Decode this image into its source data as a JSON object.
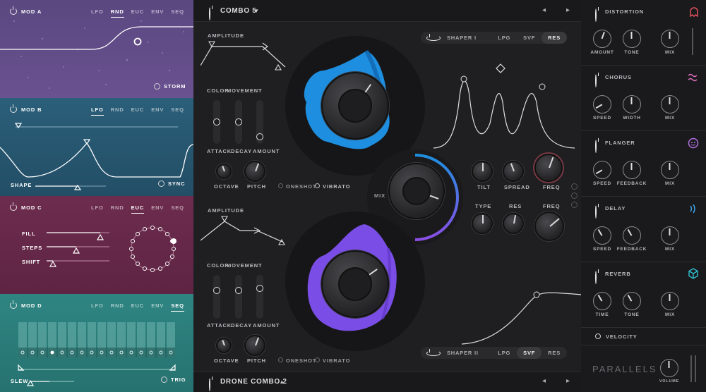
{
  "mods": [
    {
      "title": "MOD A",
      "tabs": [
        "LFO",
        "RND",
        "EUC",
        "ENV",
        "SEQ"
      ],
      "active": 1,
      "extra": "STORM",
      "color": "#5e4a7f"
    },
    {
      "title": "MOD B",
      "tabs": [
        "LFO",
        "RND",
        "EUC",
        "ENV",
        "SEQ"
      ],
      "active": 0,
      "shape_label": "SHAPE",
      "extra": "SYNC",
      "color": "#2a5a74"
    },
    {
      "title": "MOD C",
      "tabs": [
        "LFO",
        "RND",
        "EUC",
        "ENV",
        "SEQ"
      ],
      "active": 2,
      "rows": [
        "FILL",
        "STEPS",
        "SHIFT"
      ],
      "color": "#6a2a4a"
    },
    {
      "title": "MOD D",
      "tabs": [
        "LFO",
        "RND",
        "EUC",
        "ENV",
        "SEQ"
      ],
      "active": 4,
      "slew": "SLEW",
      "extra": "TRIG",
      "color": "#2d7d7a"
    }
  ],
  "center": {
    "preset_top": "COMBO 5",
    "preset_top_arrow": "▾",
    "preset_bottom": "DRONE COMBO 2",
    "preset_bottom_arrow": "▴",
    "nav_prev": "◂",
    "nav_next": "▸",
    "amplitude": "AMPLITUDE",
    "color": "COLOR",
    "movement": "MOVEMENT",
    "attack": "ATTACK",
    "decay": "DECAY",
    "amount": "AMOUNT",
    "octave": "OCTAVE",
    "pitch": "PITCH",
    "oneshot": "ONESHOT",
    "vibrato": "VIBRATO",
    "mix": "MIX",
    "shaper1": {
      "name": "SHAPER I",
      "opts": [
        "LPG",
        "SVF",
        "RES"
      ],
      "sel": 2
    },
    "shaper2": {
      "name": "SHAPER II",
      "opts": [
        "LPG",
        "SVF",
        "RES"
      ],
      "sel": 1
    },
    "tilt": "TILT",
    "spread": "SPREAD",
    "freq": "FREQ",
    "type": "TYPE",
    "res": "RES",
    "accent_blue": "#1e8fe0",
    "accent_purple": "#7a4ee6"
  },
  "fx": [
    {
      "name": "DISTORTION",
      "knobs": [
        "AMOUNT",
        "TONE"
      ],
      "mix": "MIX",
      "icon": "ghost-icon",
      "icon_color": "#e0505a"
    },
    {
      "name": "CHORUS",
      "knobs": [
        "SPEED",
        "WIDTH"
      ],
      "mix": "MIX",
      "icon": "wave-icon",
      "icon_color": "#e070c0"
    },
    {
      "name": "FLANGER",
      "knobs": [
        "SPEED",
        "FEEDBACK"
      ],
      "mix": "MIX",
      "icon": "face-icon",
      "icon_color": "#b070e0"
    },
    {
      "name": "DELAY",
      "knobs": [
        "SPEED",
        "FEEDBACK"
      ],
      "mix": "MIX",
      "icon": "signal-icon",
      "icon_color": "#40a0e0"
    },
    {
      "name": "REVERB",
      "knobs": [
        "TIME",
        "TONE"
      ],
      "mix": "MIX",
      "icon": "cube-icon",
      "icon_color": "#30c0d0"
    }
  ],
  "velocity": "VELOCITY",
  "brand": "PARALLELS",
  "volume": "VOLUME"
}
